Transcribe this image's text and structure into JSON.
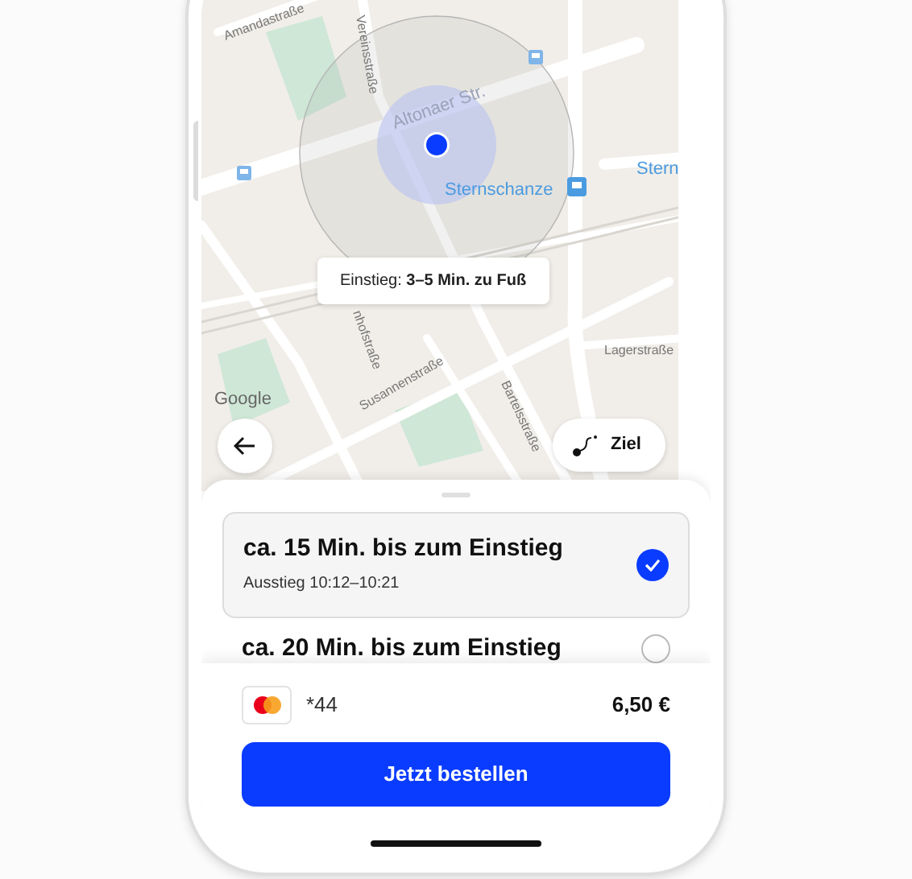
{
  "map": {
    "street_labels": [
      "Amandastraße",
      "Vereinsstraße",
      "Altonaer Str.",
      "nhofstraße",
      "Susannenstraße",
      "Bartelsstraße",
      "Lagerstraße"
    ],
    "station_labels": [
      "Sternschanze",
      "Stern"
    ],
    "attribution": "Google",
    "tooltip": "Einstieg: **3–5 Min. zu Fuß**",
    "destination_button": "Ziel"
  },
  "options": [
    {
      "title": "ca. 15 Min. bis zum Einstieg",
      "subtitle": "Ausstieg 10:12–10:21",
      "selected": true
    },
    {
      "title": "ca. 20 Min. bis zum Einstieg",
      "selected": false
    }
  ],
  "payment": {
    "card": "*44",
    "price": "6,50 €"
  },
  "order_button": "Jetzt bestellen"
}
